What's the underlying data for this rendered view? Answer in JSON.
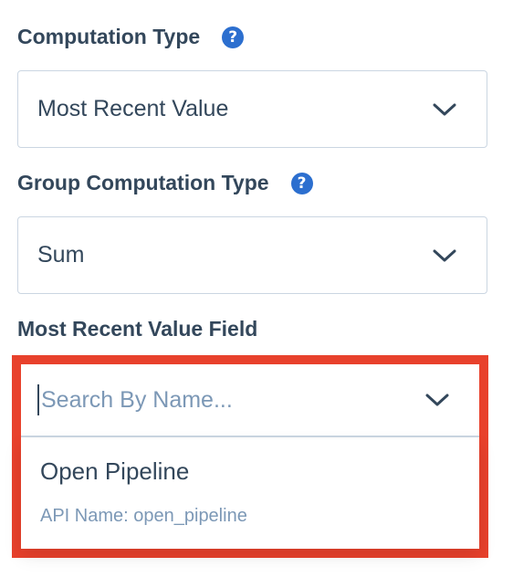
{
  "fields": {
    "computation_type": {
      "label": "Computation Type",
      "value": "Most Recent Value",
      "help_icon": "question-circle-icon"
    },
    "group_computation_type": {
      "label": "Group Computation Type",
      "value": "Sum",
      "help_icon": "question-circle-icon"
    },
    "most_recent_value_field": {
      "label": "Most Recent Value Field",
      "search_placeholder": "Search By Name...",
      "search_value": "",
      "options": [
        {
          "title": "Open Pipeline",
          "subtitle": "API Name: open_pipeline"
        }
      ]
    }
  },
  "colors": {
    "text": "#33475b",
    "muted": "#7c98b6",
    "border": "#cbd6e2",
    "help_icon": "#2c6fcf",
    "highlight": "#e8412c"
  }
}
